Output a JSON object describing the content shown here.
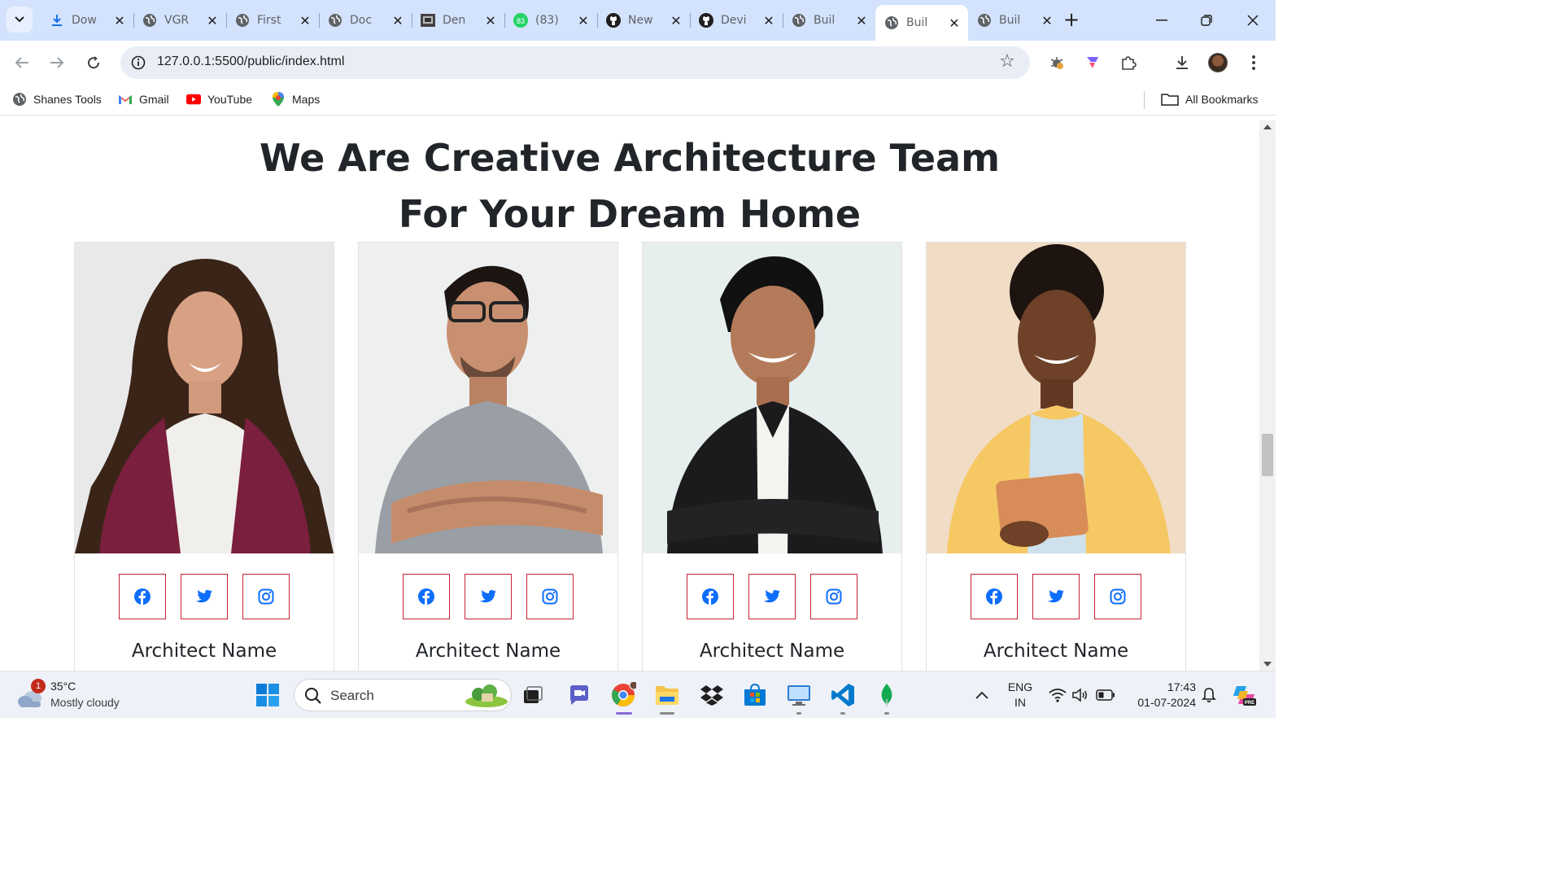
{
  "browser": {
    "tabs": [
      {
        "title": "Dow",
        "icon": "download-icon"
      },
      {
        "title": "VGR",
        "icon": "globe-icon"
      },
      {
        "title": "First",
        "icon": "globe-icon"
      },
      {
        "title": "Doc",
        "icon": "globe-icon"
      },
      {
        "title": "Den",
        "icon": "site-thumbnail-icon"
      },
      {
        "title": "(83)",
        "icon": "whatsapp-icon",
        "badge": "83"
      },
      {
        "title": "New",
        "icon": "github-icon"
      },
      {
        "title": "Devi",
        "icon": "github-icon"
      },
      {
        "title": "Buil",
        "icon": "globe-icon"
      },
      {
        "title": "Buil",
        "icon": "globe-icon",
        "active": true
      },
      {
        "title": "Buil",
        "icon": "globe-icon"
      }
    ],
    "new_tab": "+",
    "url": "127.0.0.1:5500/public/index.html",
    "bookmarks": [
      {
        "label": "Shanes Tools",
        "icon": "globe-icon"
      },
      {
        "label": "Gmail",
        "icon": "gmail-icon"
      },
      {
        "label": "YouTube",
        "icon": "youtube-icon"
      },
      {
        "label": "Maps",
        "icon": "maps-pin-icon"
      }
    ],
    "all_bookmarks": "All Bookmarks"
  },
  "page": {
    "headline_line1": "We Are Creative Architecture Team",
    "headline_line2": "For Your Dream Home",
    "team": [
      {
        "name": "Architect Name",
        "photo": "woman-maroon-cardigan"
      },
      {
        "name": "Architect Name",
        "photo": "man-glasses-grey-tee"
      },
      {
        "name": "Architect Name",
        "photo": "man-black-blazer"
      },
      {
        "name": "Architect Name",
        "photo": "woman-yellow-blazer-tablet"
      }
    ],
    "social_icons": [
      "facebook-icon",
      "twitter-icon",
      "instagram-icon"
    ],
    "accent_color": "#c82333",
    "icon_color": "#0d6efd"
  },
  "taskbar": {
    "weather_badge": "1",
    "temperature": "35°C",
    "condition": "Mostly cloudy",
    "search_label": "Search",
    "lang_line1": "ENG",
    "lang_line2": "IN",
    "time": "17:43",
    "date": "01-07-2024"
  }
}
